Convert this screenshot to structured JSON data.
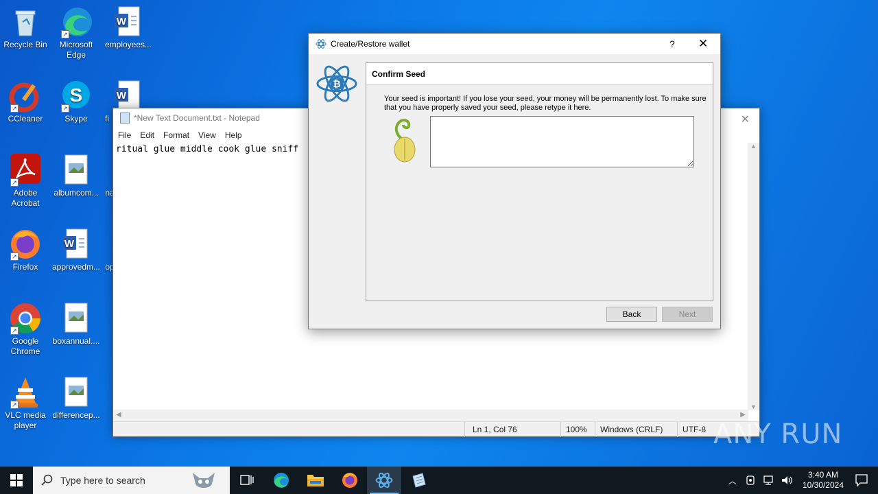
{
  "desktop": {
    "icons": [
      {
        "label": "Recycle Bin"
      },
      {
        "label": "Microsoft Edge"
      },
      {
        "label": "employees..."
      },
      {
        "label": "CCleaner"
      },
      {
        "label": "Skype"
      },
      {
        "label": "fi"
      },
      {
        "label": "Adobe Acrobat"
      },
      {
        "label": "albumcom..."
      },
      {
        "label": "na"
      },
      {
        "label": "Firefox"
      },
      {
        "label": "approvedm..."
      },
      {
        "label": "op"
      },
      {
        "label": "Google Chrome"
      },
      {
        "label": "boxannual...."
      },
      {
        "label": "VLC media player"
      },
      {
        "label": "differencep..."
      }
    ]
  },
  "notepad": {
    "title": "*New Text Document.txt - Notepad",
    "menu": [
      "File",
      "Edit",
      "Format",
      "View",
      "Help"
    ],
    "content": "ritual glue middle cook glue sniff",
    "status": {
      "position": "Ln 1, Col 76",
      "zoom": "100%",
      "line_ending": "Windows (CRLF)",
      "encoding": "UTF-8"
    }
  },
  "dialog": {
    "title": "Create/Restore wallet",
    "help": "?",
    "close": "✕",
    "panel_title": "Confirm Seed",
    "message": "Your seed is important! If you lose your seed, your money will be permanently lost. To make sure that you have properly saved your seed, please retype it here.",
    "seed_value": "",
    "back_label": "Back",
    "next_label": "Next"
  },
  "taskbar": {
    "search_placeholder": "Type here to search",
    "time": "3:40 AM",
    "date": "10/30/2024"
  },
  "watermark": "ANY RUN"
}
